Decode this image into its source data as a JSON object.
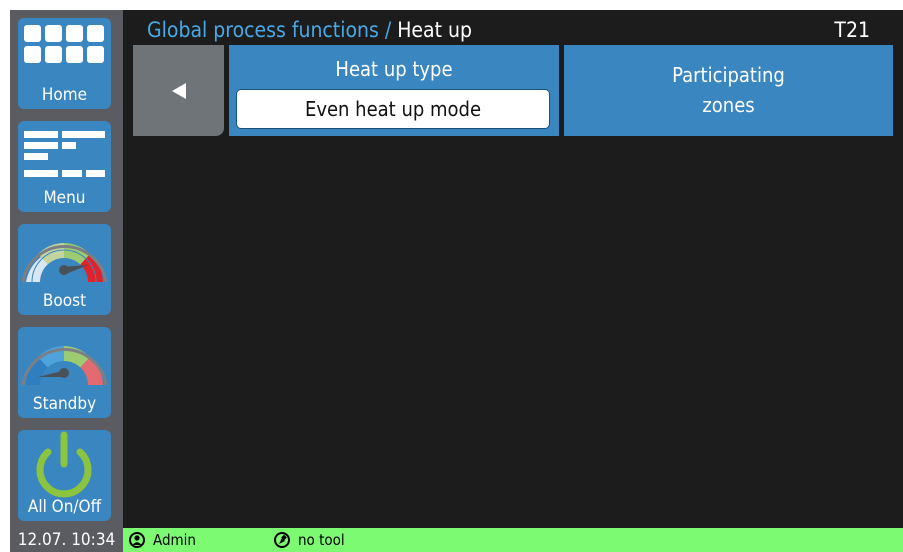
{
  "header": {
    "breadcrumb": "Global process functions",
    "separator": " / ",
    "current": "Heat up",
    "tool_id": "T21"
  },
  "sidebar": {
    "items": [
      {
        "label": "Home",
        "icon": "grid-icon"
      },
      {
        "label": "Menu",
        "icon": "menu-list-icon"
      },
      {
        "label": "Boost",
        "icon": "gauge-boost-icon"
      },
      {
        "label": "Standby",
        "icon": "gauge-standby-icon"
      },
      {
        "label": "All On/Off",
        "icon": "power-icon"
      }
    ]
  },
  "panel": {
    "back_icon": "triangle-left-icon",
    "heat_up_type_label": "Heat up type",
    "heat_up_type_value": "Even heat up mode",
    "zones_line1": "Participating",
    "zones_line2": "zones"
  },
  "status": {
    "datetime": "12.07. 10:34",
    "user": "Admin",
    "user_icon": "user-icon",
    "tool": "no tool",
    "tool_icon": "tool-icon"
  },
  "colors": {
    "accent_blue": "#3a86c0",
    "title_blue": "#49a9e6",
    "status_green": "#7cfa72",
    "background": "#1c1c1c",
    "sidebar_gray": "#5b5b62"
  }
}
